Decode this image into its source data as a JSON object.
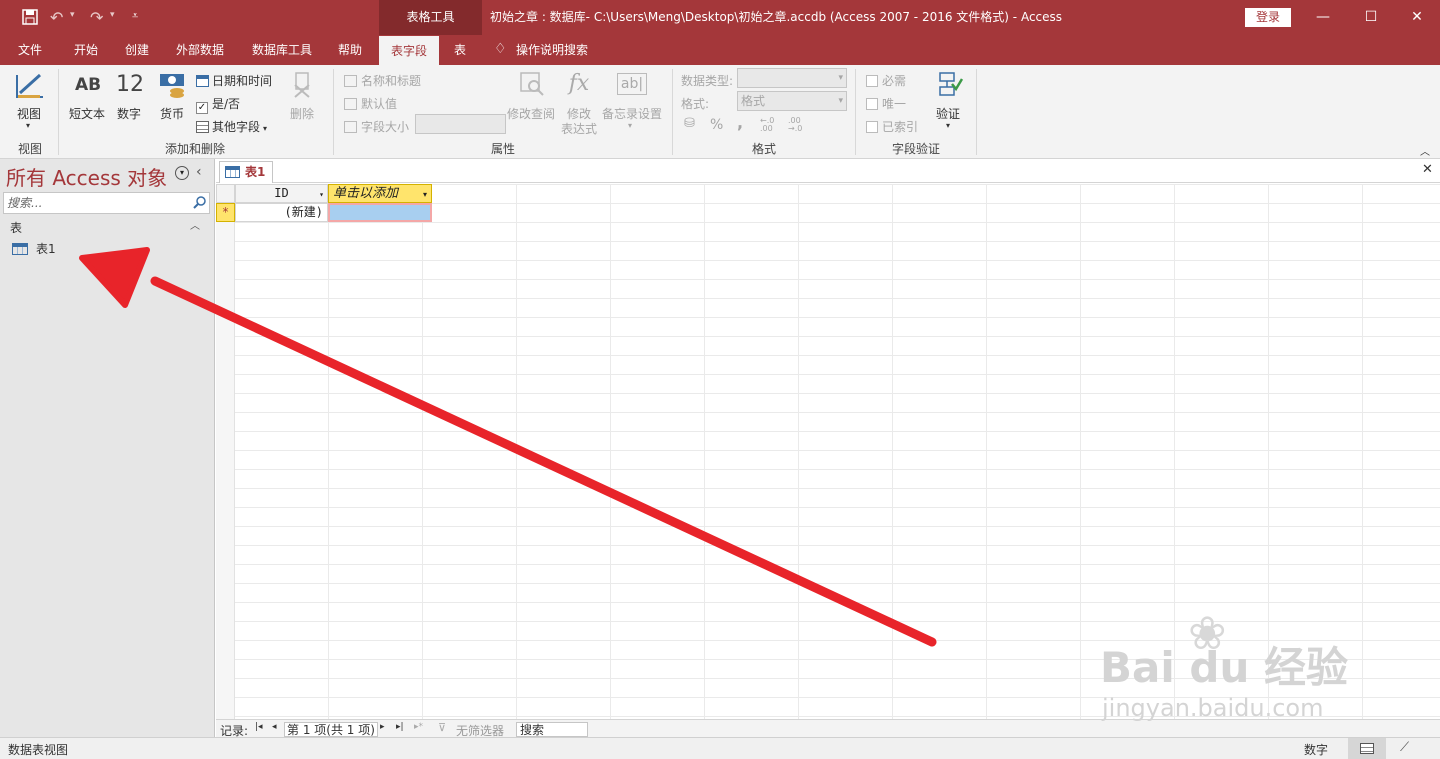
{
  "titlebar": {
    "context_tab": "表格工具",
    "title": "初始之章 : 数据库- C:\\Users\\Meng\\Desktop\\初始之章.accdb (Access 2007 - 2016 文件格式)  -  Access",
    "login": "登录",
    "save_icon": "save-icon",
    "undo_icon": "undo-icon",
    "redo_icon": "redo-icon"
  },
  "tabs": [
    "文件",
    "开始",
    "创建",
    "外部数据",
    "数据库工具",
    "帮助",
    "表字段",
    "表",
    "操作说明搜索"
  ],
  "ribbon": {
    "view": {
      "label": "视图",
      "group": "视图"
    },
    "add_delete": {
      "short_text": "短文本",
      "number": "数字",
      "currency": "货币",
      "datetime": "日期和时间",
      "yesno": "是/否",
      "more_fields": "其他字段",
      "delete": "删除",
      "group": "添加和删除",
      "ab_glyph": "AB",
      "num_glyph": "12"
    },
    "properties": {
      "name_caption": "名称和标题",
      "default_value": "默认值",
      "field_size": "字段大小",
      "modify_lookup": "修改查阅",
      "modify_expr_1": "修改",
      "modify_expr_2": "表达式",
      "memo_settings": "备忘录设置",
      "group": "属性",
      "fx_glyph": "fx",
      "ab_box_glyph": "ab|"
    },
    "format": {
      "data_type": "数据类型:",
      "format_label": "格式:",
      "format_value": "格式",
      "group": "格式",
      "percent": "%",
      "comma": ",",
      "inc_decimal": "←.0 .00",
      "dec_decimal": ".00 →.0"
    },
    "validation": {
      "required": "必需",
      "unique": "唯一",
      "indexed": "已索引",
      "validate": "验证",
      "group": "字段验证"
    }
  },
  "nav": {
    "title": "所有 Access 对象",
    "search_placeholder": "搜索...",
    "section": "表",
    "item": "表1"
  },
  "document": {
    "tab": "表1",
    "columns": [
      "ID",
      "单击以添加"
    ],
    "new_row_marker": "*",
    "new_row_id": "(新建)"
  },
  "record_nav": {
    "label": "记录:",
    "position": "第 1 项(共 1 项)",
    "no_filter": "无筛选器",
    "search": "搜索"
  },
  "status": {
    "left": "数据表视图",
    "mode": "数字"
  },
  "watermark": {
    "brand": "Bai du 经验",
    "url": "jingyan.baidu.com"
  },
  "colors": {
    "brand": "#a4373a",
    "arrow": "#e8242a",
    "header_highlight": "#ffe46c",
    "selected_cell": "#a8cff0"
  }
}
